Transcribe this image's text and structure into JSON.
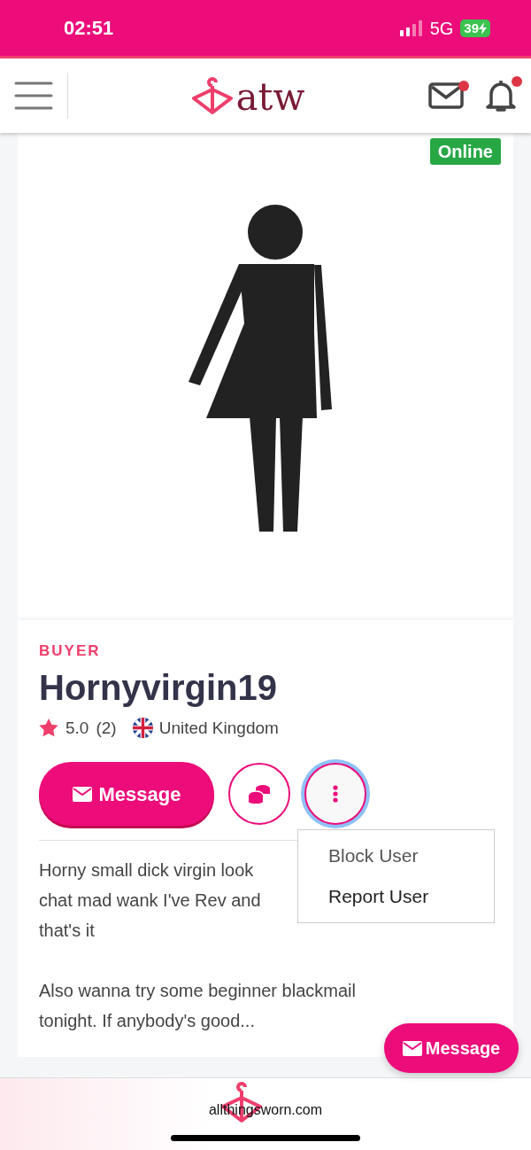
{
  "status_bar": {
    "time": "02:51",
    "network": "5G",
    "battery": "39"
  },
  "navbar": {
    "logo": "atw",
    "mail_unread": true,
    "bell_unread": true
  },
  "profile": {
    "status_badge": "Online",
    "role": "BUYER",
    "name": "Hornyvirgin19",
    "rating": "5.0",
    "reviews": "(2)",
    "country": "United Kingdom"
  },
  "actions": {
    "message": "Message",
    "menu_open": true,
    "menu_items": [
      {
        "label": "Block User",
        "muted": true
      },
      {
        "label": "Report User",
        "muted": false
      }
    ]
  },
  "bio": [
    [
      "Horny small dick virgin look",
      "chat mad wank I've Rev and",
      "that's it"
    ],
    [
      "Also wanna try some beginner blackmail",
      "tonight. If anybody's good..."
    ]
  ],
  "floating_button": "Message",
  "footer": {
    "url": "allthingsworn.com"
  }
}
